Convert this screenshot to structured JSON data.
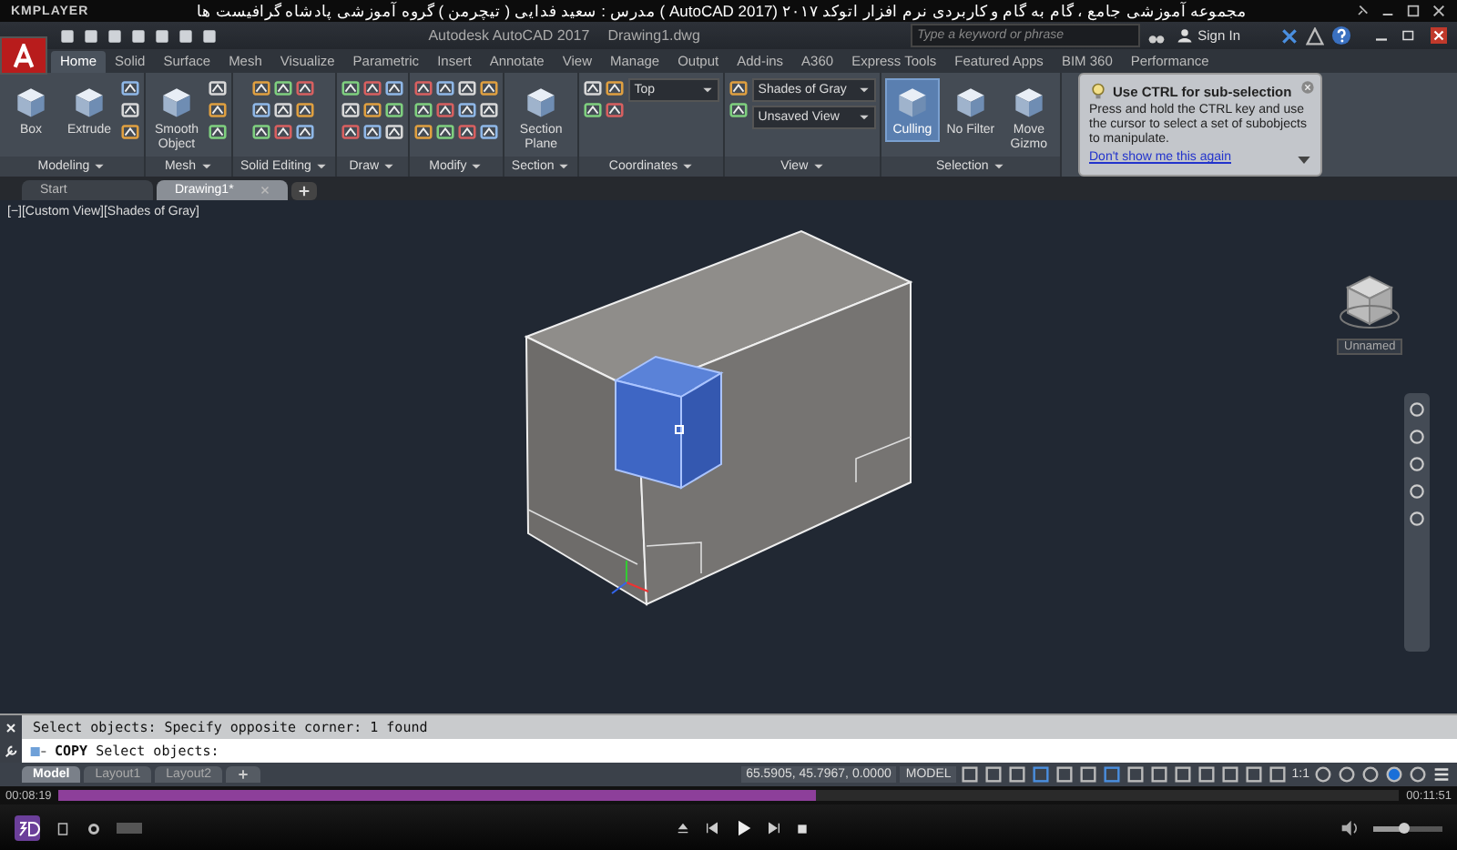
{
  "player": {
    "brand": "KMPLAYER",
    "title": "مجموعه آموزشی جامع ، گام به گام و کاربردی نرم افزار  اتوکد ۲۰۱۷ (AutoCAD 2017 )  مدرس : سعید فدایی ( تیچرمن ) گروه آموزشی پادشاه گرافیست ها",
    "elapsed": "00:08:19",
    "total": "00:11:51",
    "progress": {
      "level": 0.565
    },
    "volume": {
      "level": 0.45
    }
  },
  "app": {
    "title": "Autodesk AutoCAD 2017",
    "file": "Drawing1.dwg",
    "search": {
      "placeholder": "Type a keyword or phrase"
    },
    "sign_in": "Sign In"
  },
  "ribbon_tabs": [
    {
      "label": "Home",
      "selected": true
    },
    {
      "label": "Solid",
      "selected": false
    },
    {
      "label": "Surface",
      "selected": false
    },
    {
      "label": "Mesh",
      "selected": false
    },
    {
      "label": "Visualize",
      "selected": false
    },
    {
      "label": "Parametric",
      "selected": false
    },
    {
      "label": "Insert",
      "selected": false
    },
    {
      "label": "Annotate",
      "selected": false
    },
    {
      "label": "View",
      "selected": false
    },
    {
      "label": "Manage",
      "selected": false
    },
    {
      "label": "Output",
      "selected": false
    },
    {
      "label": "Add-ins",
      "selected": false
    },
    {
      "label": "A360",
      "selected": false
    },
    {
      "label": "Express Tools",
      "selected": false
    },
    {
      "label": "Featured Apps",
      "selected": false
    },
    {
      "label": "BIM 360",
      "selected": false
    },
    {
      "label": "Performance",
      "selected": false
    }
  ],
  "panels": [
    {
      "title": "Modeling",
      "tools": [
        {
          "label": "Box"
        },
        {
          "label": "Extrude"
        }
      ]
    },
    {
      "title": "Mesh",
      "tools": [
        {
          "label": "Smooth Object"
        }
      ]
    },
    {
      "title": "Solid Editing"
    },
    {
      "title": "Draw"
    },
    {
      "title": "Modify"
    },
    {
      "title": "Section",
      "tools": [
        {
          "label": "Section Plane"
        }
      ]
    },
    {
      "title": "Coordinates",
      "dropdowns": [
        "Top"
      ]
    },
    {
      "title": "View",
      "dropdowns": [
        "Shades of Gray",
        "Unsaved View"
      ]
    },
    {
      "title": "Selection",
      "tools": [
        {
          "label": "Culling",
          "on": true
        },
        {
          "label": "No Filter",
          "on": false
        },
        {
          "label": "Move Gizmo",
          "on": false
        }
      ]
    }
  ],
  "tooltip": {
    "title": "Use CTRL for sub-selection",
    "body": "Press and hold the CTRL key and use the cursor to select a set of subobjects to manipulate.",
    "link": "Don't show me this again"
  },
  "file_tabs": [
    {
      "label": "Start",
      "selected": false
    },
    {
      "label": "Drawing1*",
      "selected": true
    }
  ],
  "viewport": {
    "label": "[−][Custom View][Shades of Gray]",
    "viewcube_label": "Unnamed"
  },
  "command": {
    "history": "Select objects: Specify opposite corner: 1 found",
    "prompt": "**COPY** Select objects:"
  },
  "layout_tabs": [
    {
      "label": "Model",
      "selected": true
    },
    {
      "label": "Layout1",
      "selected": false
    },
    {
      "label": "Layout2",
      "selected": false
    }
  ],
  "status": {
    "coordinates": "65.5905, 45.7967, 0.0000",
    "space": "MODEL",
    "scale": "1:1"
  }
}
